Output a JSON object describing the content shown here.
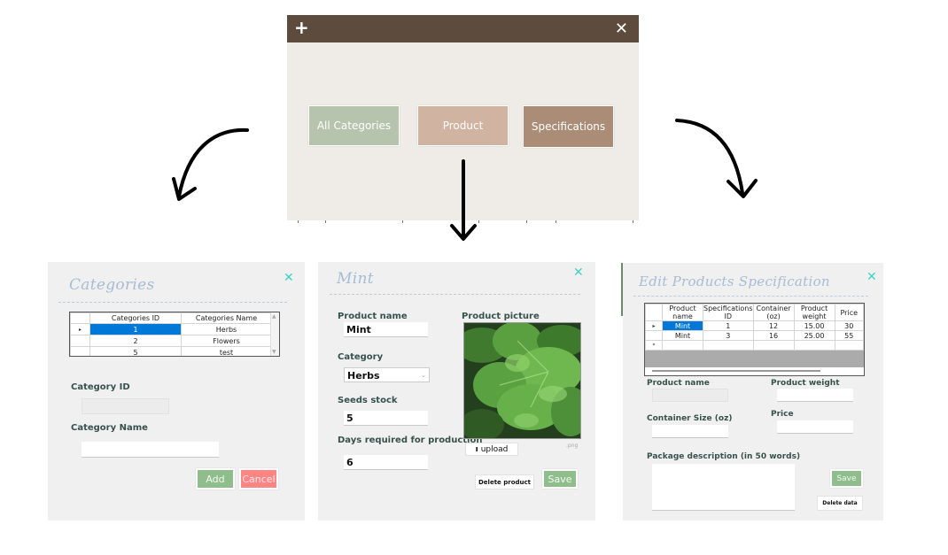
{
  "main_window": {
    "add_icon": "plus-icon",
    "close_icon": "close-icon",
    "buttons": [
      {
        "label": "All Categories",
        "color": "#b6c3ad"
      },
      {
        "label": "Product",
        "color": "#d0b3a0"
      },
      {
        "label": "Specifications",
        "color": "#ab8c77"
      }
    ],
    "titlebar_color": "#5d4b3e"
  },
  "categories_panel": {
    "title": "Categories",
    "close_icon": "close-icon",
    "table": {
      "columns": [
        "Categories ID",
        "Categories Name"
      ],
      "rows": [
        {
          "current": true,
          "cells": [
            "1",
            "Herbs"
          ]
        },
        {
          "current": false,
          "cells": [
            "2",
            "Flowers"
          ]
        },
        {
          "current": false,
          "cells": [
            "5",
            "test"
          ]
        }
      ],
      "current_row_marker": "▸"
    },
    "category_id_label": "Category ID",
    "category_id_value": "",
    "category_name_label": "Category Name",
    "category_name_value": "",
    "add_label": "Add",
    "cancel_label": "Cancel"
  },
  "product_panel": {
    "title": "Mint",
    "close_icon": "close-icon",
    "product_name_label": "Product name",
    "product_name_value": "Mint",
    "category_label": "Category",
    "category_value": "Herbs",
    "seeds_stock_label": "Seeds stock",
    "seeds_stock_value": "5",
    "days_label": "Days required for production",
    "days_value": "6",
    "picture_label": "Product picture",
    "picture_subject": "mint leaves",
    "upload_label": "upload",
    "upload_icon": "upload-icon",
    "file_ext_hint": ".png",
    "delete_label": "Delete product",
    "save_label": "Save"
  },
  "spec_panel": {
    "title": "Edit Products Specification",
    "close_icon": "close-icon",
    "table": {
      "columns": [
        "Product name",
        "Specifications ID",
        "Container (oz)",
        "Product weight",
        "Price"
      ],
      "rows": [
        {
          "marker": "▸",
          "cells": [
            "Mint",
            "1",
            "12",
            "15.00",
            "30"
          ]
        },
        {
          "marker": "",
          "cells": [
            "Mint",
            "3",
            "16",
            "25.00",
            "55"
          ]
        },
        {
          "marker": "*",
          "cells": [
            "",
            "",
            "",
            "",
            ""
          ]
        }
      ]
    },
    "product_name_label": "Product name",
    "product_name_value": "",
    "product_weight_label": "Product weight",
    "product_weight_value": "",
    "container_label": "Container Size (oz)",
    "container_value": "",
    "price_label": "Price",
    "price_value": "",
    "description_label": "Package description (in 50 words)",
    "description_value": "",
    "save_label": "Save",
    "delete_label": "Delete data"
  }
}
